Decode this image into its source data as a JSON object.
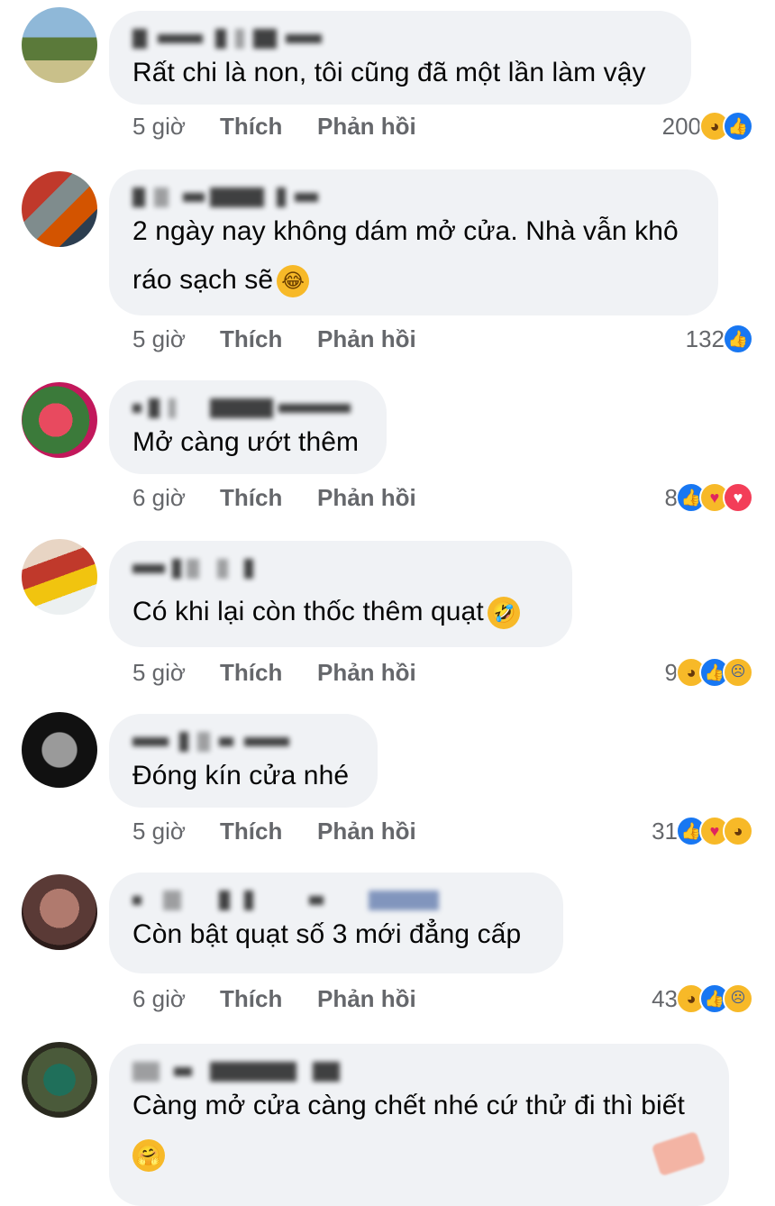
{
  "comments": [
    {
      "text_lines": [
        "Rất chi là non, tôi cũng đã một lần làm vậy"
      ],
      "inline_emoji": "",
      "time": "5 giờ",
      "like": "Thích",
      "reply": "Phản hồi",
      "count": "200",
      "reactions": [
        "haha",
        "like"
      ]
    },
    {
      "text_lines": [
        "2 ngày nay không dám mở cửa. Nhà vẫn khô",
        "ráo sạch sẽ"
      ],
      "inline_emoji": "😂",
      "time": "5 giờ",
      "like": "Thích",
      "reply": "Phản hồi",
      "count": "132",
      "reactions": [
        "like"
      ]
    },
    {
      "text_lines": [
        "Mở càng ướt thêm"
      ],
      "inline_emoji": "",
      "time": "6 giờ",
      "like": "Thích",
      "reply": "Phản hồi",
      "count": "8",
      "reactions": [
        "like",
        "care",
        "love"
      ]
    },
    {
      "text_lines": [
        "Có khi lại còn thốc thêm quạt"
      ],
      "inline_emoji": "🤣",
      "time": "5 giờ",
      "like": "Thích",
      "reply": "Phản hồi",
      "count": "9",
      "reactions": [
        "haha",
        "like",
        "sad"
      ]
    },
    {
      "text_lines": [
        "Đóng kín cửa nhé"
      ],
      "inline_emoji": "",
      "time": "5 giờ",
      "like": "Thích",
      "reply": "Phản hồi",
      "count": "31",
      "reactions": [
        "like",
        "care",
        "haha"
      ]
    },
    {
      "text_lines": [
        "Còn bật quạt số 3 mới đẳng cấp"
      ],
      "inline_emoji": "",
      "time": "6 giờ",
      "like": "Thích",
      "reply": "Phản hồi",
      "count": "43",
      "reactions": [
        "haha",
        "like",
        "sad"
      ]
    },
    {
      "text_lines": [
        "Càng mở cửa càng chết nhé cứ thử đi thì biết",
        ""
      ],
      "inline_emoji": "🤗",
      "time": "",
      "like": "",
      "reply": "",
      "count": "",
      "reactions": []
    }
  ],
  "colors": {
    "like": "#1877f2",
    "haha": "#f7b928",
    "love": "#f33e58",
    "meta": "#65676b",
    "bubble": "#f0f2f5"
  },
  "icons": {
    "like": "thumbs-up-icon",
    "haha": "laughing-face-icon",
    "care": "care-hug-icon",
    "love": "heart-icon",
    "sad": "sad-face-icon"
  }
}
